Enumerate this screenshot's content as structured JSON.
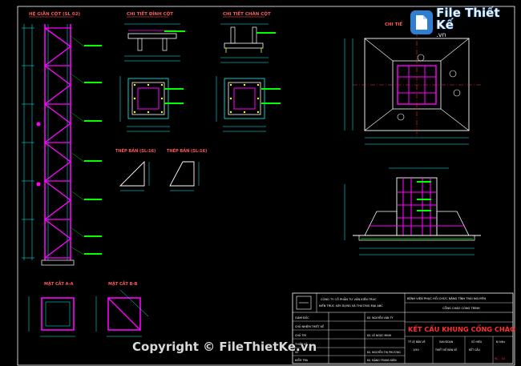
{
  "labels": {
    "he_gian_cot": "HỆ GIẰN CỘT (SL 02)",
    "chi_tiet_dinh_cot": "CHI TIẾT ĐỈNH CỘT",
    "chi_tiet_chan_cot": "CHI TIẾT CHÂN CỘT",
    "chi_tiet_mong": "CHI TIẾ",
    "thep_ban_1": "THÉP BẢN (SL:16)",
    "thep_ban_2": "THÉP BẢN (SL:16)",
    "mat_cat_aa": "MẶT CẮT A-A",
    "mat_cat_bb": "MẶT CẮT B-B"
  },
  "title_block": {
    "company": "CÔNG TY CỔ PHẦN TƯ VẤN KIẾN TRÚC",
    "company_sub": "KIẾN TRÚC XÂY DỰNG VÀ THƯƠNG MẠI ABC",
    "client": "BỆNH VIỆN PHỤC HỒI CHỨC NĂNG TỈNH THÁI NGUYÊN",
    "project": "CỔNG CHÀO CÔNG TRÌNH",
    "drawing_title": "KẾT CẤU KHUNG CỔNG CHÀO",
    "rows_left": [
      "GIÁM ĐỐC",
      "CHỦ NHIỆM THIẾT KẾ",
      "CHỦ TRÌ",
      "THIẾT KẾ",
      "VẼ",
      "KIỂM TRA"
    ],
    "rows_mid": [
      "KS. NGUYỄN VĂN TÝ",
      "",
      "KS. LÊ NGỌC MINH",
      "",
      "KS. NGUYỄN THỊ PHƯƠNG",
      "KS. ĐẶNG TRUNG KIÊN"
    ],
    "cells": [
      "TỶ LỆ BẢN VẼ",
      "1/50",
      "GIAI ĐOẠN",
      "THIẾT KẾ BẢN VẼ",
      "SỐ HIỆU",
      "KẾT CẤU",
      "Kí hiệu",
      "KC - 02"
    ]
  },
  "watermark": {
    "logo_text": "File Thiết Kế",
    "logo_sub": ".vn",
    "copyright": "Copyright © FileThietKe.vn"
  },
  "colors": {
    "background": "#000000",
    "magenta": "#ff00ff",
    "cyan": "#00ffff",
    "green": "#00ff00",
    "white": "#ffffff",
    "red": "#ff3030",
    "yellow": "#ffff00",
    "label_red": "#ff5a5a"
  }
}
